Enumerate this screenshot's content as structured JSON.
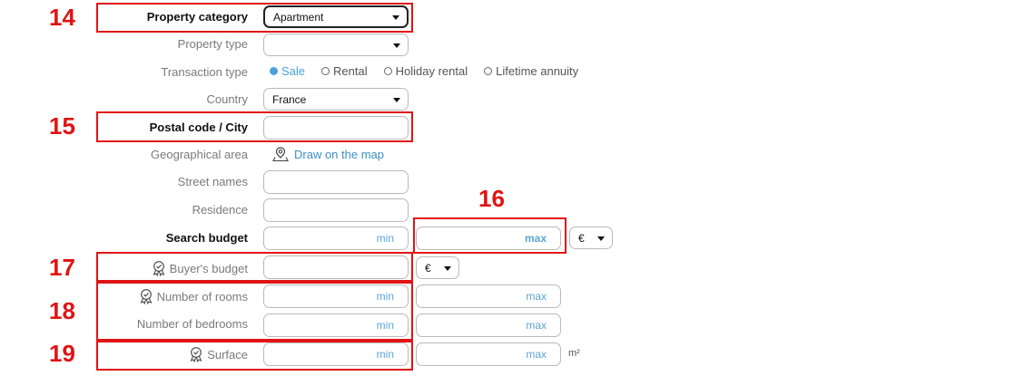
{
  "annotations": {
    "n14": "14",
    "n15": "15",
    "n16": "16",
    "n17": "17",
    "n18": "18",
    "n19": "19"
  },
  "property_category": {
    "label": "Property category",
    "value": "Apartment"
  },
  "property_type": {
    "label": "Property type",
    "value": ""
  },
  "transaction_type": {
    "label": "Transaction type",
    "options": [
      "Sale",
      "Rental",
      "Holiday rental",
      "Lifetime annuity"
    ],
    "selected": "Sale"
  },
  "country": {
    "label": "Country",
    "value": "France"
  },
  "postal_code": {
    "label": "Postal code / City",
    "value": ""
  },
  "geo_area": {
    "label": "Geographical area",
    "link": "Draw on the map"
  },
  "street_names": {
    "label": "Street names"
  },
  "residence": {
    "label": "Residence"
  },
  "search_budget": {
    "label": "Search budget",
    "min": "min",
    "max": "max",
    "currency": "€"
  },
  "buyers_budget": {
    "label": "Buyer's budget",
    "currency": "€"
  },
  "rooms": {
    "label": "Number of rooms",
    "min": "min",
    "max": "max"
  },
  "bedrooms": {
    "label": "Number of bedrooms",
    "min": "min",
    "max": "max"
  },
  "surface": {
    "label": "Surface",
    "min": "min",
    "max": "max",
    "unit": "m²"
  },
  "colors": {
    "annotation_red": "#e01414",
    "accent_blue": "#4ba3de"
  }
}
